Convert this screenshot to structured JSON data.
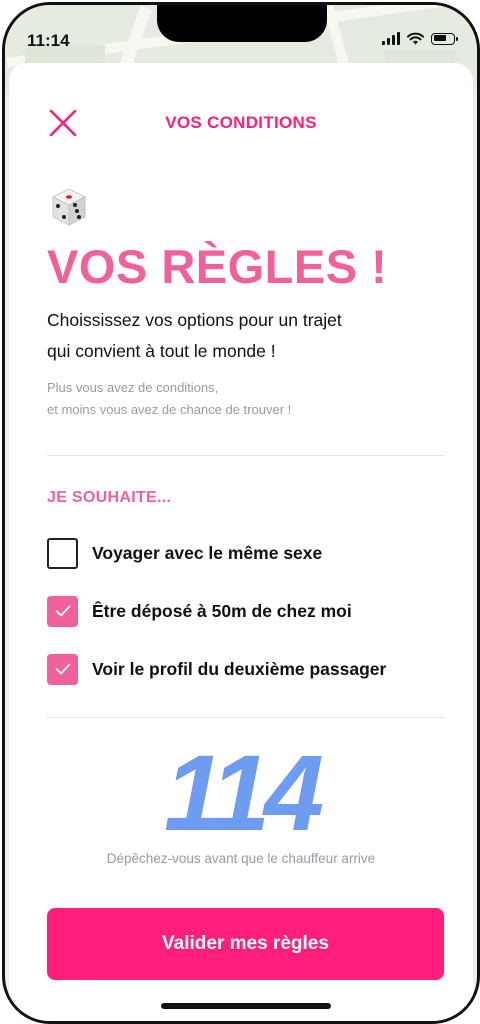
{
  "status_bar": {
    "time": "11:14"
  },
  "header": {
    "title": "VOS CONDITIONS"
  },
  "hero": {
    "title": "VOS RÈGLES !",
    "intro_line1": "Choississez vos options pour un trajet",
    "intro_line2": "qui convient à tout le monde !",
    "note_line1": "Plus vous avez de conditions,",
    "note_line2": "et moins vous avez de chance de trouver !"
  },
  "options_section": {
    "label": "JE SOUHAITE...",
    "options": [
      {
        "label": "Voyager avec le même sexe",
        "checked": false
      },
      {
        "label": "Être déposé à 50m de chez moi",
        "checked": true
      },
      {
        "label": "Voir le profil du deuxième passager",
        "checked": true
      }
    ]
  },
  "counter": {
    "value": "114",
    "caption": "Dépêchez-vous avant que le chauffeur arrive"
  },
  "cta": {
    "label": "Valider mes règles"
  },
  "colors": {
    "accent": "#ff1f7a",
    "title_pink": "#f0609b",
    "counter_blue": "#6e9cf0",
    "muted": "#9a9aa6"
  },
  "icons": {
    "close": "close-icon",
    "dice": "dice-icon",
    "check": "check-icon"
  }
}
